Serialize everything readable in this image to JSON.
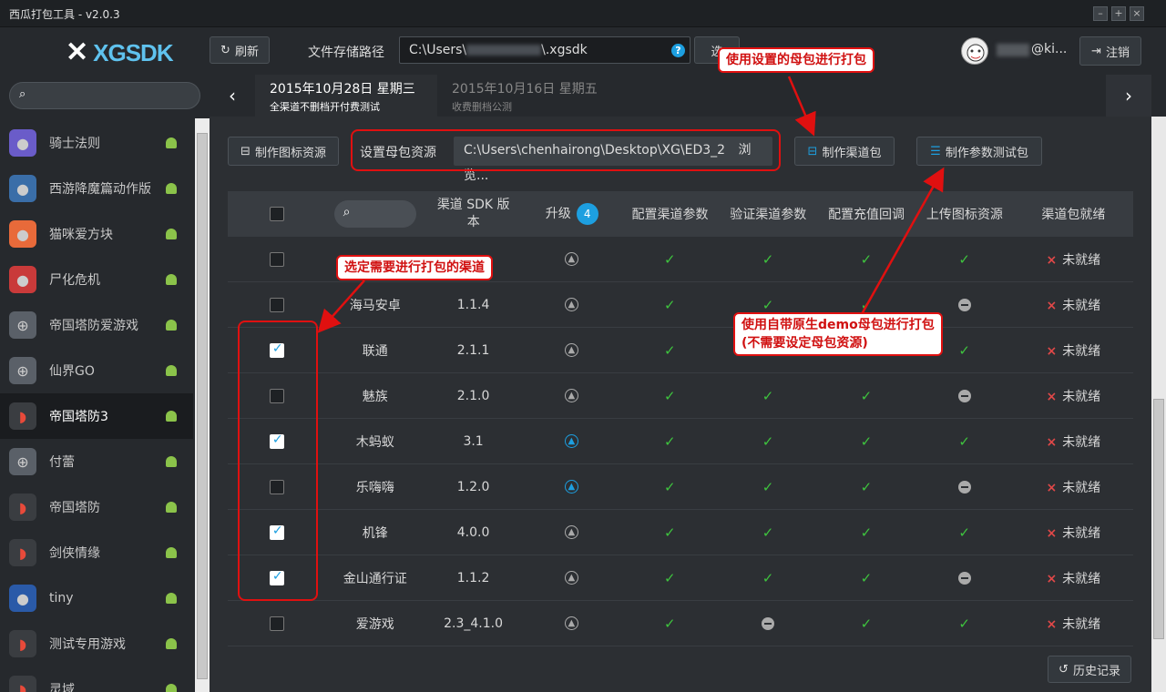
{
  "window": {
    "title": "西瓜打包工具 - v2.0.3"
  },
  "header": {
    "logo": "XGSDK",
    "refresh_label": "刷新",
    "path_label": "文件存储路径",
    "path_value": "C:\\Users\\",
    "path_suffix": "\\.xgsdk",
    "choose_label": "选",
    "user_name": "@ki...",
    "logout_label": "注销"
  },
  "sidebar": {
    "search_placeholder": "",
    "games": [
      {
        "name": "骑士法则",
        "icon": "knight-game-icon",
        "color": "#6a5cc9"
      },
      {
        "name": "西游降魔篇动作版",
        "icon": "journey-game-icon",
        "color": "#3a6ea8"
      },
      {
        "name": "猫咪爱方块",
        "icon": "cat-game-icon",
        "color": "#e86a3a"
      },
      {
        "name": "尸化危机",
        "icon": "zombie-game-icon",
        "color": "#c93a3a"
      },
      {
        "name": "帝国塔防爱游戏",
        "icon": "gamepad-icon",
        "color": "#5a6068"
      },
      {
        "name": "仙界GO",
        "icon": "gamepad-icon",
        "color": "#5a6068"
      },
      {
        "name": "帝国塔防3",
        "icon": "watermelon-icon",
        "color": "#3a3d41"
      },
      {
        "name": "付蕾",
        "icon": "gamepad-icon",
        "color": "#5a6068"
      },
      {
        "name": "帝国塔防",
        "icon": "watermelon-icon",
        "color": "#3a3d41"
      },
      {
        "name": "剑侠情缘",
        "icon": "watermelon-icon",
        "color": "#3a3d41"
      },
      {
        "name": "tiny",
        "icon": "tiny-game-icon",
        "color": "#2a5aa8"
      },
      {
        "name": "测试专用游戏",
        "icon": "watermelon-icon",
        "color": "#3a3d41"
      },
      {
        "name": "灵域",
        "icon": "watermelon-icon",
        "color": "#3a3d41"
      }
    ]
  },
  "dates": [
    {
      "date": "2015年10月28日 星期三",
      "desc": "全渠道不删档开付费测试"
    },
    {
      "date": "2015年10月16日 星期五",
      "desc": "收费删档公测"
    }
  ],
  "toolbar": {
    "make_icon": "制作图标资源",
    "mother_label": "设置母包资源",
    "mother_path": "C:\\Users\\chenhairong\\Desktop\\XG\\ED3_2",
    "browse": "浏览...",
    "make_channel": "制作渠道包",
    "make_test": "制作参数测试包"
  },
  "table": {
    "headers": {
      "version": "渠道 SDK 版本",
      "upgrade": "升级",
      "upgrade_count": "4",
      "config": "配置渠道参数",
      "verify": "验证渠道参数",
      "pay": "配置充值回调",
      "upload": "上传图标资源",
      "ready": "渠道包就绪"
    },
    "rows": [
      {
        "checked": false,
        "name": "",
        "version": "",
        "up": "grey",
        "c": "ok",
        "v": "ok",
        "p": "ok",
        "u": "ok",
        "ready": "未就绪"
      },
      {
        "checked": false,
        "name": "海马安卓",
        "version": "1.1.4",
        "up": "grey",
        "c": "ok",
        "v": "ok",
        "p": "ok",
        "u": "minus",
        "ready": "未就绪"
      },
      {
        "checked": true,
        "name": "联通",
        "version": "2.1.1",
        "up": "grey",
        "c": "ok",
        "v": "",
        "p": "",
        "u": "ok",
        "ready": "未就绪"
      },
      {
        "checked": false,
        "name": "魅族",
        "version": "2.1.0",
        "up": "grey",
        "c": "ok",
        "v": "ok",
        "p": "ok",
        "u": "minus",
        "ready": "未就绪"
      },
      {
        "checked": true,
        "name": "木蚂蚁",
        "version": "3.1",
        "up": "blue",
        "c": "ok",
        "v": "ok",
        "p": "ok",
        "u": "ok",
        "ready": "未就绪"
      },
      {
        "checked": false,
        "name": "乐嗨嗨",
        "version": "1.2.0",
        "up": "blue",
        "c": "ok",
        "v": "ok",
        "p": "ok",
        "u": "minus",
        "ready": "未就绪"
      },
      {
        "checked": true,
        "name": "机锋",
        "version": "4.0.0",
        "up": "grey",
        "c": "ok",
        "v": "ok",
        "p": "ok",
        "u": "ok",
        "ready": "未就绪"
      },
      {
        "checked": true,
        "name": "金山通行证",
        "version": "1.1.2",
        "up": "grey",
        "c": "ok",
        "v": "ok",
        "p": "ok",
        "u": "minus",
        "ready": "未就绪"
      },
      {
        "checked": false,
        "name": "爱游戏",
        "version": "2.3_4.1.0",
        "up": "grey",
        "c": "ok",
        "v": "minus",
        "p": "ok",
        "u": "ok",
        "ready": "未就绪"
      }
    ]
  },
  "history_label": "历史记录",
  "callouts": {
    "c1": "使用设置的母包进行打包",
    "c2": "选定需要进行打包的渠道",
    "c3": "使用自带原生demo母包进行打包",
    "c3b": "(不需要设定母包资源)"
  },
  "colors": {
    "accent": "#1d9fe0",
    "ok": "#3ec33e",
    "error": "#e04848",
    "annotation": "#e01010"
  }
}
